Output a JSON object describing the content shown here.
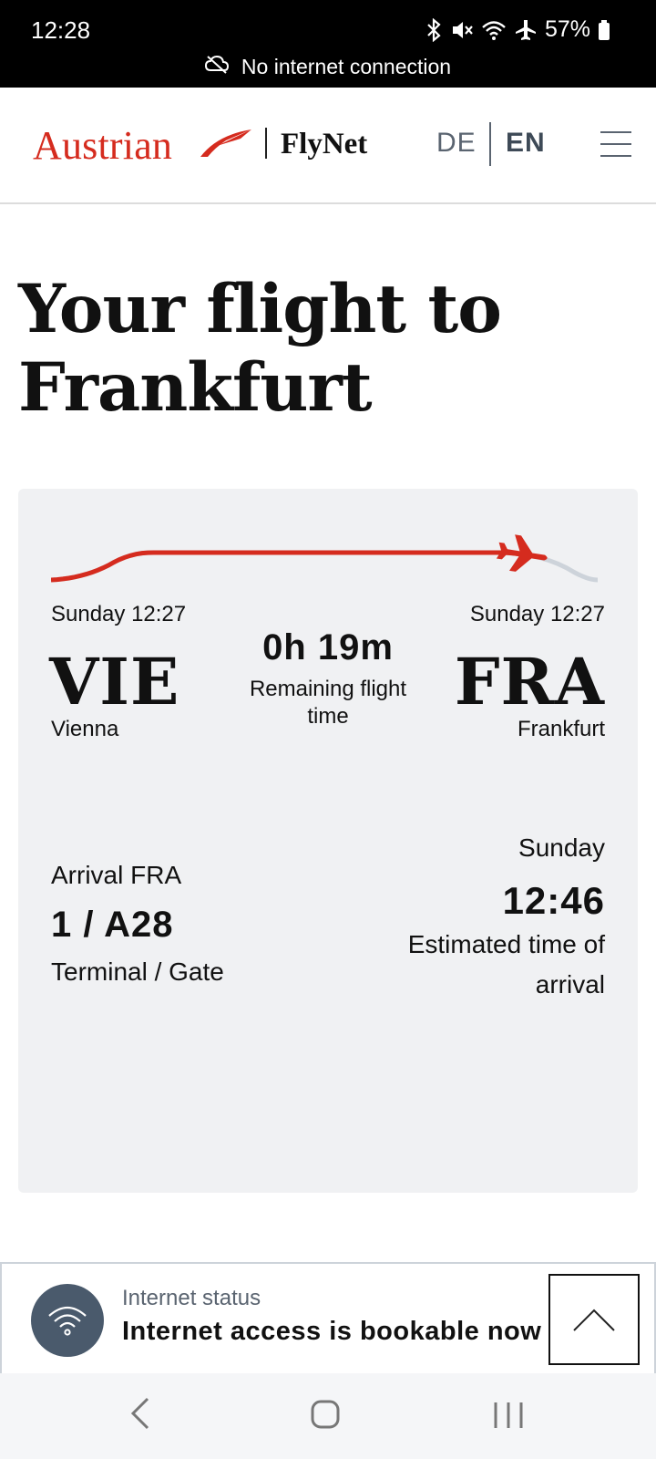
{
  "status_bar": {
    "time": "12:28",
    "battery": "57%",
    "icons": [
      "bluetooth-icon",
      "mute-icon",
      "wifi-icon",
      "airplane-icon",
      "battery-icon"
    ],
    "notice": "No internet connection"
  },
  "header": {
    "brand": "Austrian",
    "product": "FlyNet",
    "languages": [
      "DE",
      "EN"
    ],
    "active_language": "EN",
    "brand_color": "#d52b1e"
  },
  "page": {
    "title": "Your flight to Frankfurt"
  },
  "flight": {
    "progress": 0.86,
    "departure": {
      "day_time": "Sunday 12:27",
      "code": "VIE",
      "city": "Vienna"
    },
    "arrival": {
      "day_time": "Sunday 12:27",
      "code": "FRA",
      "city": "Frankfurt"
    },
    "remaining": {
      "value": "0h 19m",
      "label": "Remaining flight time"
    },
    "arrival_info": {
      "label": "Arrival FRA",
      "terminal_gate": "1 / A28",
      "terminal_gate_label": "Terminal / Gate"
    },
    "eta": {
      "day": "Sunday",
      "time": "12:46",
      "label": "Estimated time of arrival"
    }
  },
  "internet_banner": {
    "label": "Internet status",
    "text": "Internet access is bookable now"
  },
  "colors": {
    "accent": "#d52b1e",
    "card_bg": "#f0f1f3",
    "route_remaining": "#cdd3da",
    "slate": "#4a5a6c"
  }
}
